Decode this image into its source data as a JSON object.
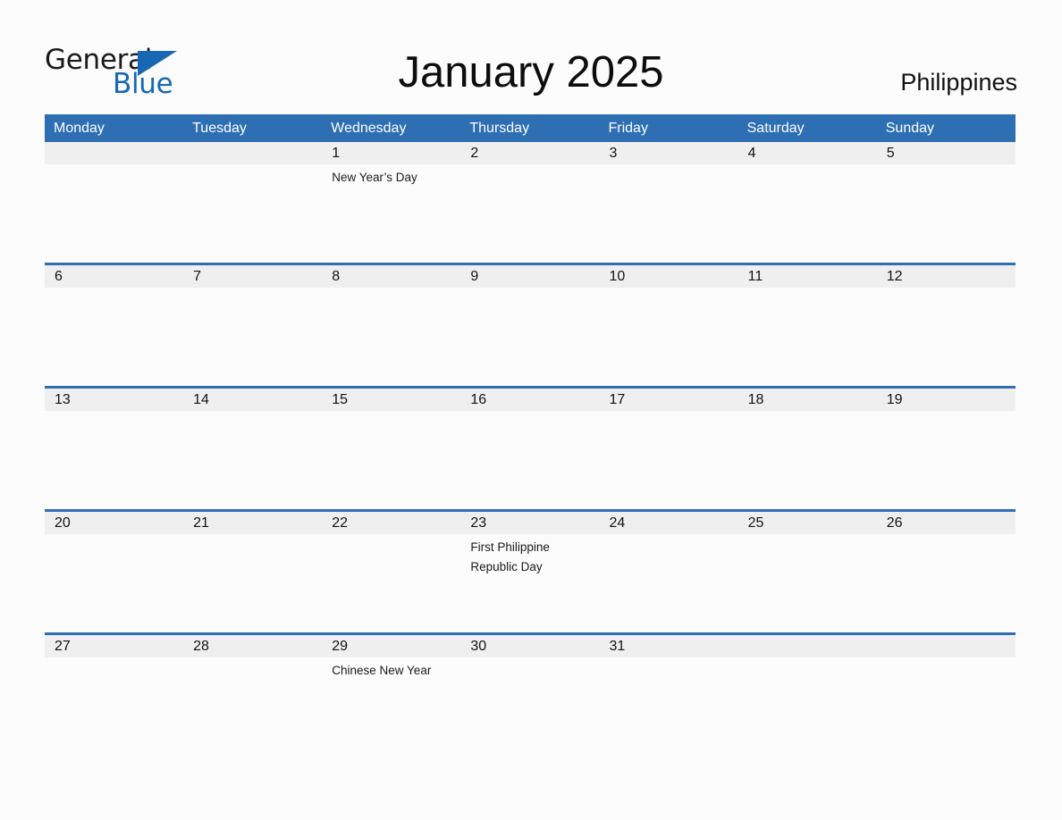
{
  "logo": {
    "word_dark": "General",
    "word_blue": "Blue",
    "triangle_icon": "blue-triangle-icon",
    "dark_color": "#1a1a1a",
    "blue_color": "#1668b3"
  },
  "header": {
    "title": "January 2025",
    "country": "Philippines"
  },
  "colors": {
    "header_blue": "#2e6fb3",
    "date_band_gray": "#efefef",
    "page_background": "#fcfcfc",
    "text": "#121212"
  },
  "calendar": {
    "month": "January",
    "year": "2025",
    "weekdays": [
      "Monday",
      "Tuesday",
      "Wednesday",
      "Thursday",
      "Friday",
      "Saturday",
      "Sunday"
    ],
    "weeks": [
      {
        "days": [
          {
            "date": "",
            "events": []
          },
          {
            "date": "",
            "events": []
          },
          {
            "date": "1",
            "events": [
              "New Year’s Day"
            ]
          },
          {
            "date": "2",
            "events": []
          },
          {
            "date": "3",
            "events": []
          },
          {
            "date": "4",
            "events": []
          },
          {
            "date": "5",
            "events": []
          }
        ]
      },
      {
        "days": [
          {
            "date": "6",
            "events": []
          },
          {
            "date": "7",
            "events": []
          },
          {
            "date": "8",
            "events": []
          },
          {
            "date": "9",
            "events": []
          },
          {
            "date": "10",
            "events": []
          },
          {
            "date": "11",
            "events": []
          },
          {
            "date": "12",
            "events": []
          }
        ]
      },
      {
        "days": [
          {
            "date": "13",
            "events": []
          },
          {
            "date": "14",
            "events": []
          },
          {
            "date": "15",
            "events": []
          },
          {
            "date": "16",
            "events": []
          },
          {
            "date": "17",
            "events": []
          },
          {
            "date": "18",
            "events": []
          },
          {
            "date": "19",
            "events": []
          }
        ]
      },
      {
        "days": [
          {
            "date": "20",
            "events": []
          },
          {
            "date": "21",
            "events": []
          },
          {
            "date": "22",
            "events": []
          },
          {
            "date": "23",
            "events": [
              "First Philippine Republic Day"
            ]
          },
          {
            "date": "24",
            "events": []
          },
          {
            "date": "25",
            "events": []
          },
          {
            "date": "26",
            "events": []
          }
        ]
      },
      {
        "days": [
          {
            "date": "27",
            "events": []
          },
          {
            "date": "28",
            "events": []
          },
          {
            "date": "29",
            "events": [
              "Chinese New Year"
            ]
          },
          {
            "date": "30",
            "events": []
          },
          {
            "date": "31",
            "events": []
          },
          {
            "date": "",
            "events": []
          },
          {
            "date": "",
            "events": []
          }
        ]
      }
    ]
  }
}
